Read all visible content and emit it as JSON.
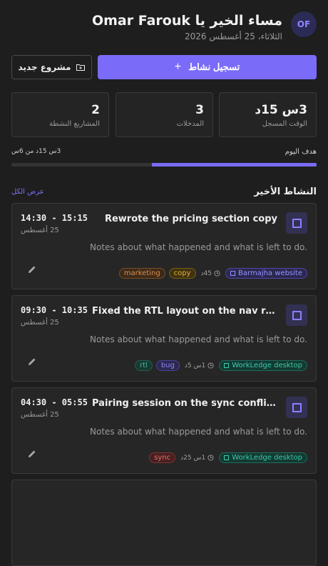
{
  "header": {
    "avatar_initials": "OF",
    "greeting": "مساء الخير يا Omar Farouk",
    "date": "الثلاثاء، 25 أغسطس 2026"
  },
  "actions": {
    "log_label": "تسجيل نشاط",
    "log_icon": "plus-icon",
    "new_project_label": "مشروع جديد",
    "new_project_icon": "folder-plus-icon"
  },
  "stats": [
    {
      "value": "3س 15د",
      "label": "الوقت المسجل"
    },
    {
      "value": "3",
      "label": "المدخلات"
    },
    {
      "value": "2",
      "label": "المشاريع النشطة"
    }
  ],
  "goal": {
    "label": "هدف اليوم",
    "value_text": "3س 15د من 6س",
    "progress": 0.54
  },
  "recent": {
    "title": "النشاط الأخير",
    "view_all": "عرض الكل",
    "note_placeholder": "Notes about what happened and what is left to do.",
    "items": [
      {
        "title": "Rewrote the pricing section copy",
        "time": "14:30 - 15:15",
        "date": "25 أغسطس",
        "project": "Barmajha website",
        "duration": "45د",
        "tags": [
          "copy",
          "marketing"
        ]
      },
      {
        "title": "Fixed the RTL layout on the nav rail",
        "time": "09:30 - 10:35",
        "date": "25 أغسطس",
        "project": "WorkLedge desktop",
        "duration": "1س 5د",
        "tags": [
          "bug",
          "rtl"
        ]
      },
      {
        "title": "Pairing session on the sync conflict r...",
        "time": "04:30 - 05:55",
        "date": "25 أغسطس",
        "project": "WorkLedge desktop",
        "duration": "1س 25د",
        "tags": [
          "sync"
        ]
      }
    ]
  },
  "colors": {
    "accent": "#7a6cf8",
    "background": "#1e1e1e",
    "card": "#262626"
  }
}
